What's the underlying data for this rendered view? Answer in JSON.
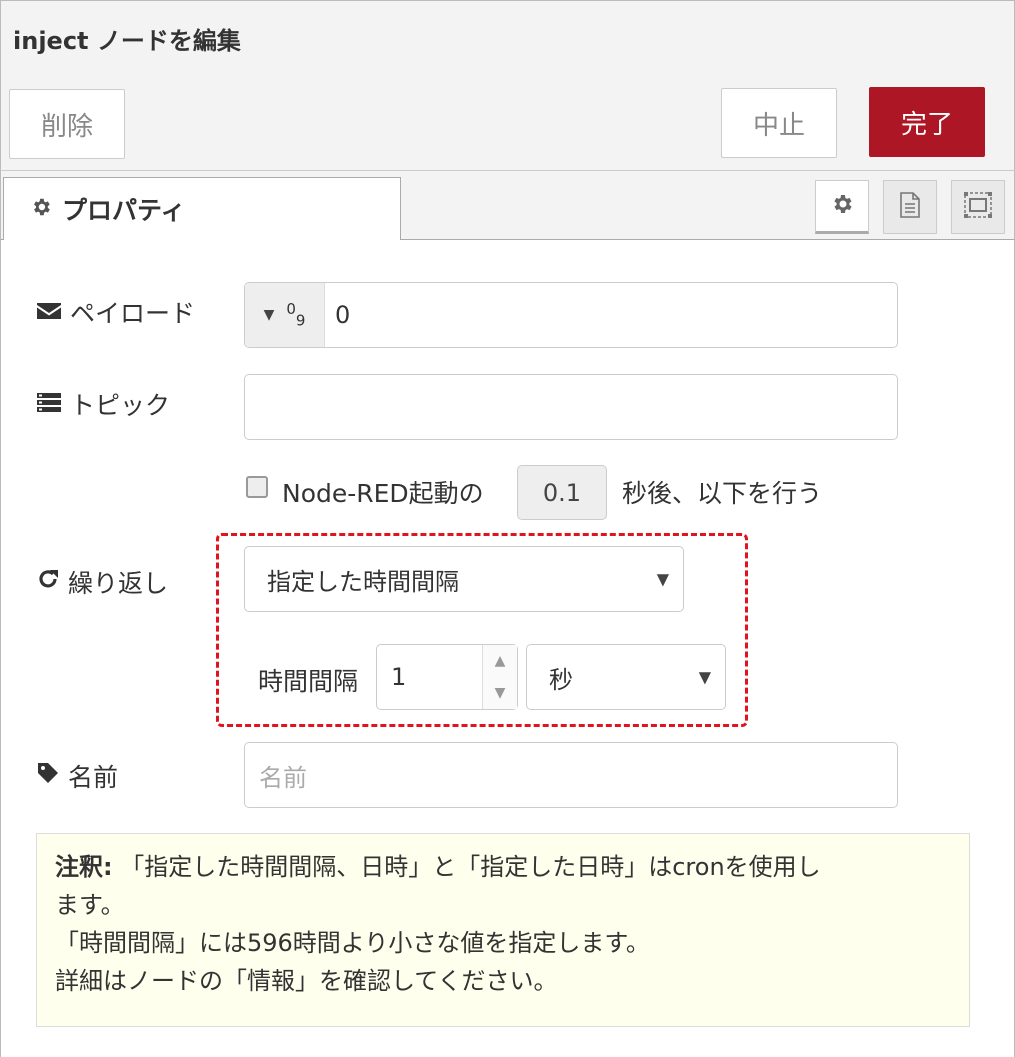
{
  "dialog": {
    "title": "inject ノードを編集"
  },
  "toolbar": {
    "delete_label": "削除",
    "cancel_label": "中止",
    "done_label": "完了"
  },
  "tabs": {
    "properties_label": "プロパティ"
  },
  "form": {
    "payload": {
      "label": "ペイロード",
      "type_glyph": "0",
      "type_glyph_sub": "9",
      "value": "0"
    },
    "topic": {
      "label": "トピック",
      "value": ""
    },
    "startup": {
      "text_before": "Node-RED起動の",
      "delay_value": "0.1",
      "text_after": "秒後、以下を行う",
      "checked": false
    },
    "repeat": {
      "label": "繰り返し",
      "mode": "指定した時間間隔",
      "interval_label": "時間間隔",
      "interval_value": "1",
      "unit": "秒"
    },
    "name": {
      "label": "名前",
      "placeholder": "名前"
    }
  },
  "note": {
    "bold": "注釈:",
    "line1": " 「指定した時間間隔、日時」と「指定した日時」はcronを使用し",
    "line2": "ます。",
    "line3": "「時間間隔」には596時間より小さな値を指定します。",
    "line4": "詳細はノードの「情報」を確認してください。"
  },
  "colors": {
    "primary": "#ad1625",
    "highlight": "#e1141e",
    "note_bg": "#ffffee"
  }
}
